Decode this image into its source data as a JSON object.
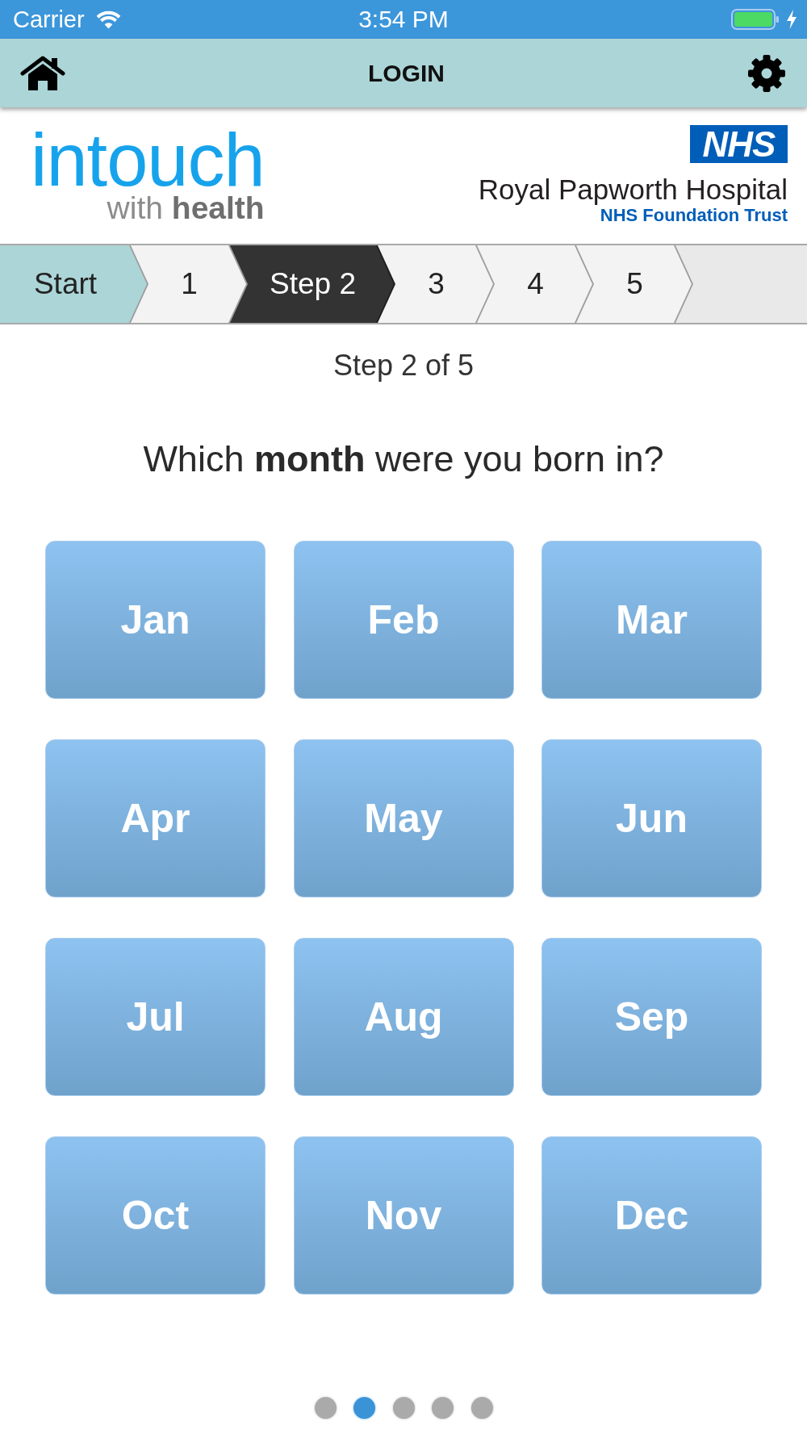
{
  "status_bar": {
    "carrier": "Carrier",
    "time": "3:54 PM",
    "charging": true
  },
  "nav_bar": {
    "title": "LOGIN"
  },
  "header": {
    "app_logo": {
      "wordmark": "intouch",
      "tagline": "with **health**"
    },
    "hospital_logo": {
      "badge": "NHS",
      "name": "Royal Papworth Hospital",
      "trust": "NHS Foundation Trust"
    }
  },
  "steps": [
    {
      "label": "Start",
      "kind": "start",
      "selected": false
    },
    {
      "label": "1",
      "kind": "step",
      "selected": false
    },
    {
      "label": "Step 2",
      "kind": "step",
      "selected": true
    },
    {
      "label": "3",
      "kind": "step",
      "selected": false
    },
    {
      "label": "4",
      "kind": "step",
      "selected": false
    },
    {
      "label": "5",
      "kind": "step",
      "selected": false
    }
  ],
  "progress_text": "Step 2 of 5",
  "question": "Which **month** were you born in?",
  "months": [
    "Jan",
    "Feb",
    "Mar",
    "Apr",
    "May",
    "Jun",
    "Jul",
    "Aug",
    "Sep",
    "Oct",
    "Nov",
    "Dec"
  ],
  "page_dots": [
    {
      "selected": false
    },
    {
      "selected": true
    },
    {
      "selected": false
    },
    {
      "selected": false
    },
    {
      "selected": false
    }
  ]
}
